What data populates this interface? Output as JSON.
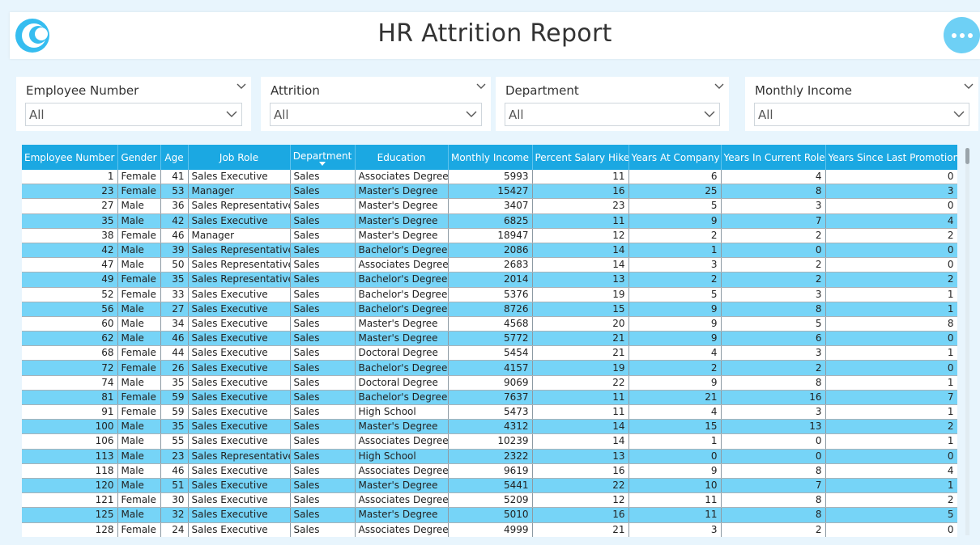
{
  "header": {
    "title": "HR Attrition Report",
    "logo_icon": "crescent-logo-icon",
    "more_icon": "more-options-icon"
  },
  "slicers": [
    {
      "label": "Employee Number",
      "value": "All"
    },
    {
      "label": "Attrition",
      "value": "All"
    },
    {
      "label": "Department",
      "value": "All"
    },
    {
      "label": "Monthly Income",
      "value": "All"
    }
  ],
  "colors": {
    "accent": "#1ba8e2",
    "row_highlight": "#76d4f7",
    "background": "#e8f5fd",
    "button": "#6ed0f5"
  },
  "table": {
    "columns": [
      "Employee Number",
      "Gender",
      "Age",
      "Job Role",
      "Department",
      "Education",
      "Monthly Income",
      "Percent Salary Hike",
      "Years At Company",
      "Years In Current Role",
      "Years Since Last Promotion"
    ],
    "sorted_column": "Department",
    "rows": [
      [
        "1",
        "Female",
        "41",
        "Sales Executive",
        "Sales",
        "Associates Degree",
        "5993",
        "11",
        "6",
        "4",
        "0"
      ],
      [
        "23",
        "Female",
        "53",
        "Manager",
        "Sales",
        "Master's Degree",
        "15427",
        "16",
        "25",
        "8",
        "3"
      ],
      [
        "27",
        "Male",
        "36",
        "Sales Representative",
        "Sales",
        "Master's Degree",
        "3407",
        "23",
        "5",
        "3",
        "0"
      ],
      [
        "35",
        "Male",
        "42",
        "Sales Executive",
        "Sales",
        "Master's Degree",
        "6825",
        "11",
        "9",
        "7",
        "4"
      ],
      [
        "38",
        "Female",
        "46",
        "Manager",
        "Sales",
        "Master's Degree",
        "18947",
        "12",
        "2",
        "2",
        "2"
      ],
      [
        "42",
        "Male",
        "39",
        "Sales Representative",
        "Sales",
        "Bachelor's Degree",
        "2086",
        "14",
        "1",
        "0",
        "0"
      ],
      [
        "47",
        "Male",
        "50",
        "Sales Representative",
        "Sales",
        "Associates Degree",
        "2683",
        "14",
        "3",
        "2",
        "0"
      ],
      [
        "49",
        "Female",
        "35",
        "Sales Representative",
        "Sales",
        "Bachelor's Degree",
        "2014",
        "13",
        "2",
        "2",
        "2"
      ],
      [
        "52",
        "Female",
        "33",
        "Sales Executive",
        "Sales",
        "Bachelor's Degree",
        "5376",
        "19",
        "5",
        "3",
        "1"
      ],
      [
        "56",
        "Male",
        "27",
        "Sales Executive",
        "Sales",
        "Bachelor's Degree",
        "8726",
        "15",
        "9",
        "8",
        "1"
      ],
      [
        "60",
        "Male",
        "34",
        "Sales Executive",
        "Sales",
        "Master's Degree",
        "4568",
        "20",
        "9",
        "5",
        "8"
      ],
      [
        "62",
        "Male",
        "46",
        "Sales Executive",
        "Sales",
        "Master's Degree",
        "5772",
        "21",
        "9",
        "6",
        "0"
      ],
      [
        "68",
        "Female",
        "44",
        "Sales Executive",
        "Sales",
        "Doctoral Degree",
        "5454",
        "21",
        "4",
        "3",
        "1"
      ],
      [
        "72",
        "Female",
        "26",
        "Sales Executive",
        "Sales",
        "Bachelor's Degree",
        "4157",
        "19",
        "2",
        "2",
        "0"
      ],
      [
        "74",
        "Male",
        "35",
        "Sales Executive",
        "Sales",
        "Doctoral Degree",
        "9069",
        "22",
        "9",
        "8",
        "1"
      ],
      [
        "81",
        "Female",
        "59",
        "Sales Executive",
        "Sales",
        "Bachelor's Degree",
        "7637",
        "11",
        "21",
        "16",
        "7"
      ],
      [
        "91",
        "Female",
        "59",
        "Sales Executive",
        "Sales",
        "High School",
        "5473",
        "11",
        "4",
        "3",
        "1"
      ],
      [
        "100",
        "Male",
        "35",
        "Sales Executive",
        "Sales",
        "Master's Degree",
        "4312",
        "14",
        "15",
        "13",
        "2"
      ],
      [
        "106",
        "Male",
        "55",
        "Sales Executive",
        "Sales",
        "Associates Degree",
        "10239",
        "14",
        "1",
        "0",
        "1"
      ],
      [
        "113",
        "Male",
        "23",
        "Sales Representative",
        "Sales",
        "High School",
        "2322",
        "13",
        "0",
        "0",
        "0"
      ],
      [
        "118",
        "Male",
        "46",
        "Sales Executive",
        "Sales",
        "Associates Degree",
        "9619",
        "16",
        "9",
        "8",
        "4"
      ],
      [
        "120",
        "Male",
        "51",
        "Sales Executive",
        "Sales",
        "Master's Degree",
        "5441",
        "22",
        "10",
        "7",
        "1"
      ],
      [
        "121",
        "Female",
        "30",
        "Sales Executive",
        "Sales",
        "Associates Degree",
        "5209",
        "12",
        "11",
        "8",
        "2"
      ],
      [
        "125",
        "Male",
        "32",
        "Sales Executive",
        "Sales",
        "Master's Degree",
        "5010",
        "16",
        "11",
        "8",
        "5"
      ],
      [
        "128",
        "Female",
        "24",
        "Sales Executive",
        "Sales",
        "Associates Degree",
        "4999",
        "21",
        "3",
        "2",
        "0"
      ]
    ]
  }
}
